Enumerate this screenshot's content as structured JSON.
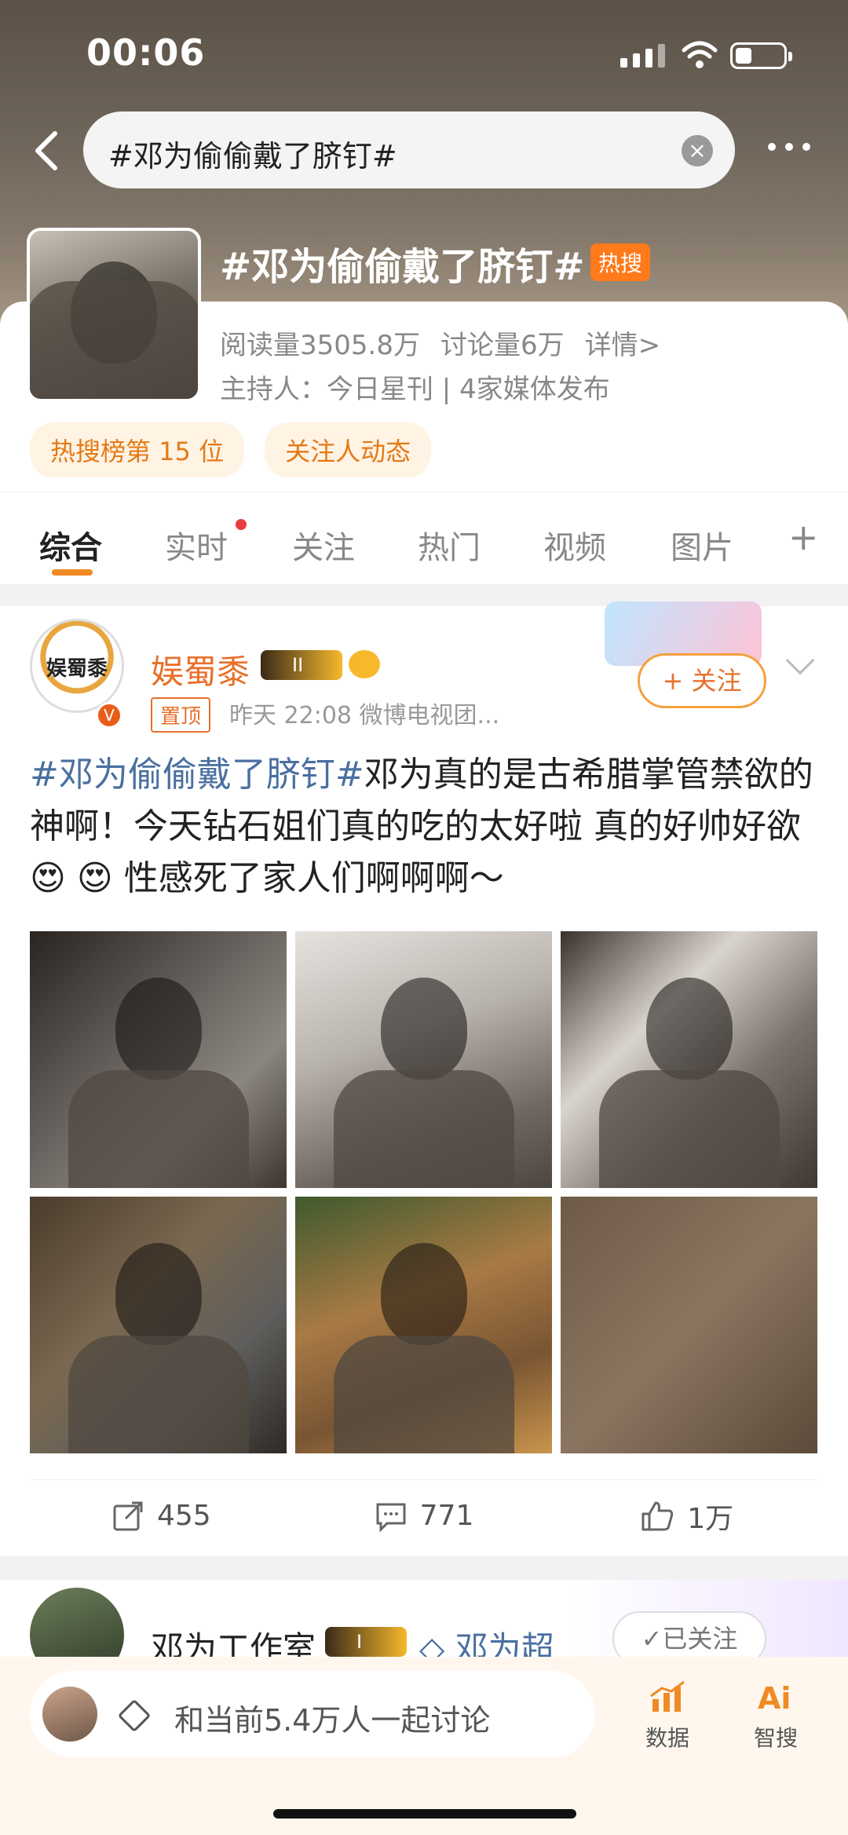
{
  "status_bar": {
    "time": "00:06"
  },
  "search": {
    "query": "#邓为偷偷戴了脐钉#"
  },
  "topic": {
    "title": "#邓为偷偷戴了脐钉#",
    "hot_badge": "热搜",
    "reads": "阅读量3505.8万",
    "discussions": "讨论量6万",
    "details_link": "详情>",
    "host_line": "主持人：今日星刊 | 4家媒体发布",
    "tags": [
      "热搜榜第 15 位",
      "关注人动态"
    ]
  },
  "tabs": [
    {
      "label": "综合",
      "active": true
    },
    {
      "label": "实时",
      "active": false
    },
    {
      "label": "关注",
      "active": false
    },
    {
      "label": "热门",
      "active": false
    },
    {
      "label": "视频",
      "active": false
    },
    {
      "label": "图片",
      "active": false
    }
  ],
  "tab_add_label": "+",
  "post1": {
    "avatar_text": "娱蜀黍",
    "username": "娱蜀黍",
    "level": "II",
    "pin_tag": "置顶",
    "meta": "昨天 22:08  微博电视团...",
    "follow_label": "+ 关注",
    "topic_link": "#邓为偷偷戴了脐钉#",
    "text": "邓为真的是古希腊掌管禁欲的神啊！今天钻石姐们真的吃的太好啦 真的好帅好欲 😍 😍 性感死了家人们啊啊啊～",
    "reposts": "455",
    "comments": "771",
    "likes": "1万"
  },
  "post2": {
    "username": "邓为工作室",
    "level": "I",
    "super_link": "◇ 邓为超",
    "followed_label": "✓已关注"
  },
  "compose": {
    "placeholder": "和当前5.4万人一起讨论",
    "data_label": "数据",
    "ai_label": "智搜"
  }
}
